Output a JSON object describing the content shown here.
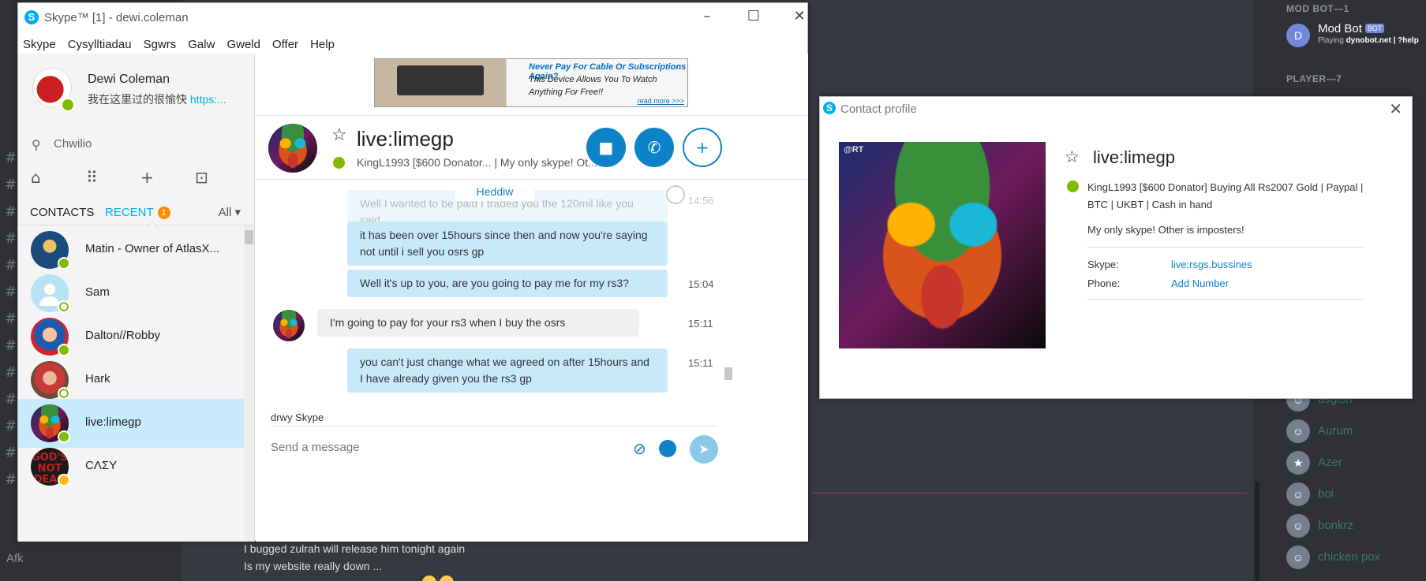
{
  "skype": {
    "title": "Skype™ [1] - dewi.coleman",
    "logo": "S",
    "menu": [
      "Skype",
      "Cysylltiadau",
      "Sgwrs",
      "Galw",
      "Gweld",
      "Offer",
      "Help"
    ],
    "me": {
      "name": "Dewi Coleman",
      "mood": "我在这里过的很愉快 ",
      "mood_link": "https:..."
    },
    "search_placeholder": "Chwilio",
    "tabs": {
      "contacts": "CONTACTS",
      "recent": "RECENT",
      "recent_badge": "1",
      "filter": "All"
    },
    "contacts": [
      {
        "name": "Matin - Owner of AtlasX...",
        "status": "online"
      },
      {
        "name": "Sam",
        "status": "offline"
      },
      {
        "name": "Dalton//Robby",
        "status": "online"
      },
      {
        "name": "Hark",
        "status": "offline"
      },
      {
        "name": "live:limegp",
        "status": "online"
      },
      {
        "name": "CΛΣΥ",
        "status": "away"
      }
    ],
    "ad": {
      "line1": "Never Pay For Cable Or Subscriptions Again?",
      "line2": "This Device Allows You To Watch",
      "line3": "Anything For Free!!",
      "more": "read more >>>"
    },
    "chat": {
      "name": "live:limegp",
      "mood": "KingL1993 [$600 Donator...  |  My only skype! Ot...",
      "date_divider": "Heddiw",
      "messages": [
        {
          "text": "Well I wanted to be paid I traded you the 120mil like you said",
          "time": "14:56",
          "dir": "out"
        },
        {
          "text": "it has been over 15hours since then and now you're saying not until i sell you osrs gp",
          "time": "",
          "dir": "out"
        },
        {
          "text": "Well it's up to you, are you going to pay me for my rs3?",
          "time": "15:04",
          "dir": "out"
        },
        {
          "text": "I'm going to pay for your rs3 when I buy the osrs",
          "time": "15:11",
          "dir": "in"
        },
        {
          "text": "you can't just change what we agreed on after 15hours and I have already given you the rs3 gp",
          "time": "15:11",
          "dir": "out"
        }
      ],
      "typing": "drwy Skype",
      "input_placeholder": "Send a message"
    }
  },
  "profile": {
    "title": "Contact profile",
    "name": "live:limegp",
    "mood": "KingL1993 [$600 Donator] Buying All Rs2007 Gold | Paypal | BTC | UKBT | Cash in hand",
    "note": "My only skype! Other is imposters!",
    "skype_label": "Skype:",
    "skype_value": "live:rsgs.bussines",
    "phone_label": "Phone:",
    "phone_value": "Add Number",
    "photo_watermark": "@RT"
  },
  "discord": {
    "afk": "Afk",
    "messages": [
      "I bugged zulrah will release him tonight again",
      "Is my website really down ..."
    ],
    "categories": [
      "MOD BOT—1",
      "PLAYER—7"
    ],
    "modbot": {
      "name": "Mod Bot",
      "tag": "BOT",
      "playing_prefix": "Playing ",
      "playing_game": "dynobot.net | ?help"
    },
    "members": [
      "asgish",
      "Aurum",
      "Azer",
      "boi",
      "bonkrz",
      "chicken pox"
    ]
  },
  "colors": {
    "skype_blue": "#00aff0",
    "online": "#7fba00",
    "away": "#fdb813",
    "bubble_out": "#c7e9fa",
    "discord_bg": "#36393f"
  }
}
